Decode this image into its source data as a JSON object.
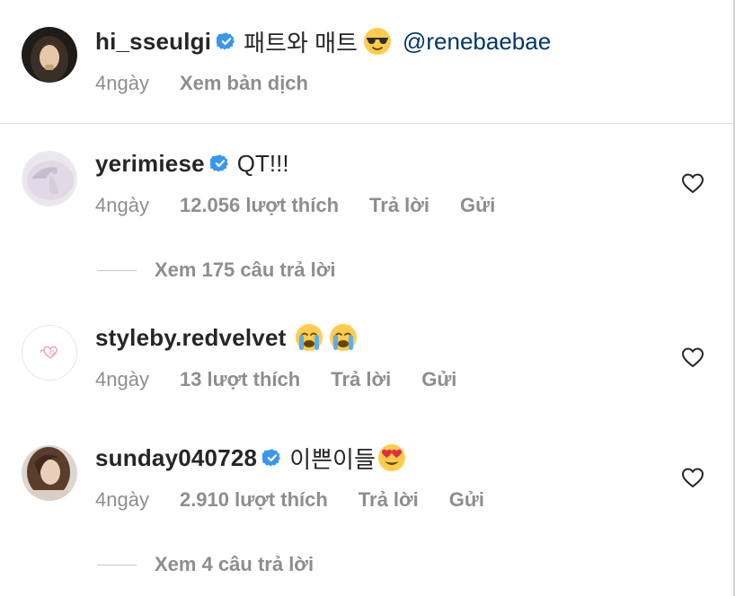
{
  "caption": {
    "username": "hi_sseulgi",
    "text": "패트와 매트",
    "emoji": "sunglasses-emoji",
    "mention": "@renebaebae",
    "time": "4ngày",
    "translate": "Xem bản dịch"
  },
  "comments": [
    {
      "username": "yerimiese",
      "verified": true,
      "text": "QT!!!",
      "time": "4ngày",
      "likes": "12.056 lượt thích",
      "reply": "Trả lời",
      "send": "Gửi",
      "view_replies": "Xem 175 câu trả lời"
    },
    {
      "username": "styleby.redvelvet",
      "verified": false,
      "text": "",
      "emojis": [
        "crying-emoji",
        "crying-emoji"
      ],
      "time": "4ngày",
      "likes": "13 lượt thích",
      "reply": "Trả lời",
      "send": "Gửi"
    },
    {
      "username": "sunday040728",
      "verified": true,
      "text": "이쁜이들",
      "emojis": [
        "heart-eyes-emoji"
      ],
      "time": "4ngày",
      "likes": "2.910 lượt thích",
      "reply": "Trả lời",
      "send": "Gửi",
      "view_replies": "Xem 4 câu trả lời"
    }
  ],
  "colors": {
    "text": "#262626",
    "secondary": "#8e8e8e",
    "mention": "#00376b",
    "verified": "#3897f0",
    "divider": "#dbdbdb"
  }
}
